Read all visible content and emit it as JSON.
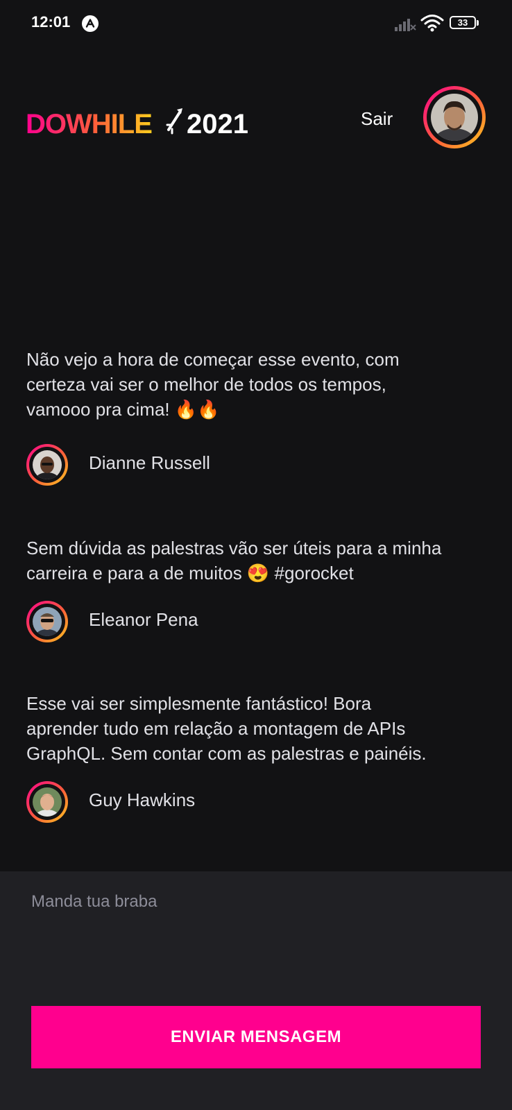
{
  "status_bar": {
    "time": "12:01",
    "app_icon": "app-notification-icon",
    "signal_icon": "cellular-signal-icon",
    "wifi_icon": "wifi-icon",
    "battery_level": "33"
  },
  "header": {
    "logo_text": "DOWHILE",
    "logo_year": "2021",
    "sign_out_label": "Sair"
  },
  "messages": [
    {
      "text": "Não vejo a hora de começar esse evento, com\ncerteza vai ser o melhor de todos os tempos,\nvamooo pra cima! 🔥🔥",
      "author": "Dianne Russell"
    },
    {
      "text": "Sem dúvida as palestras vão ser úteis para a minha\ncarreira e para a de muitos 😍 #gorocket",
      "author": "Eleanor Pena"
    },
    {
      "text": "Esse vai ser simplesmente fantástico! Bora\naprender tudo em relação a montagem de APIs\nGraphQL. Sem contar com as palestras e painéis.",
      "author": "Guy Hawkins"
    }
  ],
  "composer": {
    "placeholder": "Manda tua braba",
    "value": "",
    "send_label": "ENVIAR MENSAGEM"
  },
  "colors": {
    "background": "#121214",
    "composer_background": "#202024",
    "accent": "#ff008e",
    "gradient_start": "#ff008e",
    "gradient_end": "#ffcd1e"
  }
}
